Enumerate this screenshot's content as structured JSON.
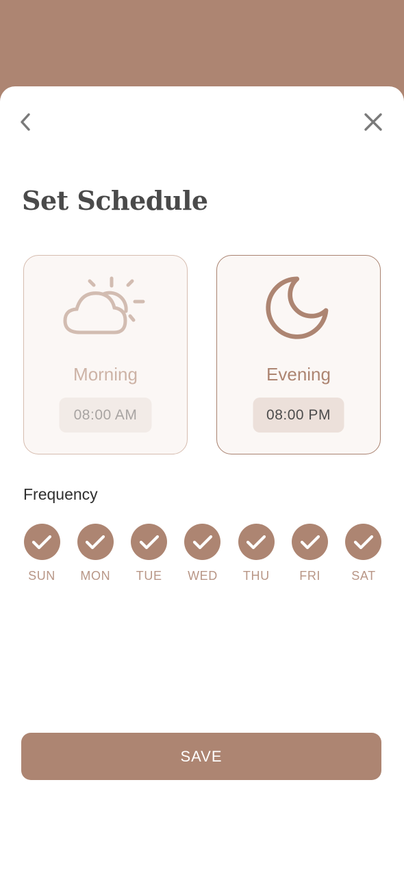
{
  "title": "Set Schedule",
  "icons": {
    "back": "chevron-left-icon",
    "close": "close-icon",
    "morning": "partly-cloudy-sun-icon",
    "evening": "moon-icon",
    "check": "check-icon"
  },
  "cards": [
    {
      "id": "morning",
      "label": "Morning",
      "time": "08:00 AM",
      "selected": false
    },
    {
      "id": "evening",
      "label": "Evening",
      "time": "08:00 PM",
      "selected": true
    }
  ],
  "frequency": {
    "label": "Frequency",
    "days": [
      {
        "label": "SUN",
        "checked": true
      },
      {
        "label": "MON",
        "checked": true
      },
      {
        "label": "TUE",
        "checked": true
      },
      {
        "label": "WED",
        "checked": true
      },
      {
        "label": "THU",
        "checked": true
      },
      {
        "label": "FRI",
        "checked": true
      },
      {
        "label": "SAT",
        "checked": true
      }
    ]
  },
  "save_label": "SAVE",
  "colors": {
    "accent": "#ad8572",
    "background": "#ffffff",
    "title_text": "#4a4a4a",
    "card_background": "#fbf7f5",
    "morning_label": "#cdb3a6",
    "day_label": "#b89686"
  }
}
